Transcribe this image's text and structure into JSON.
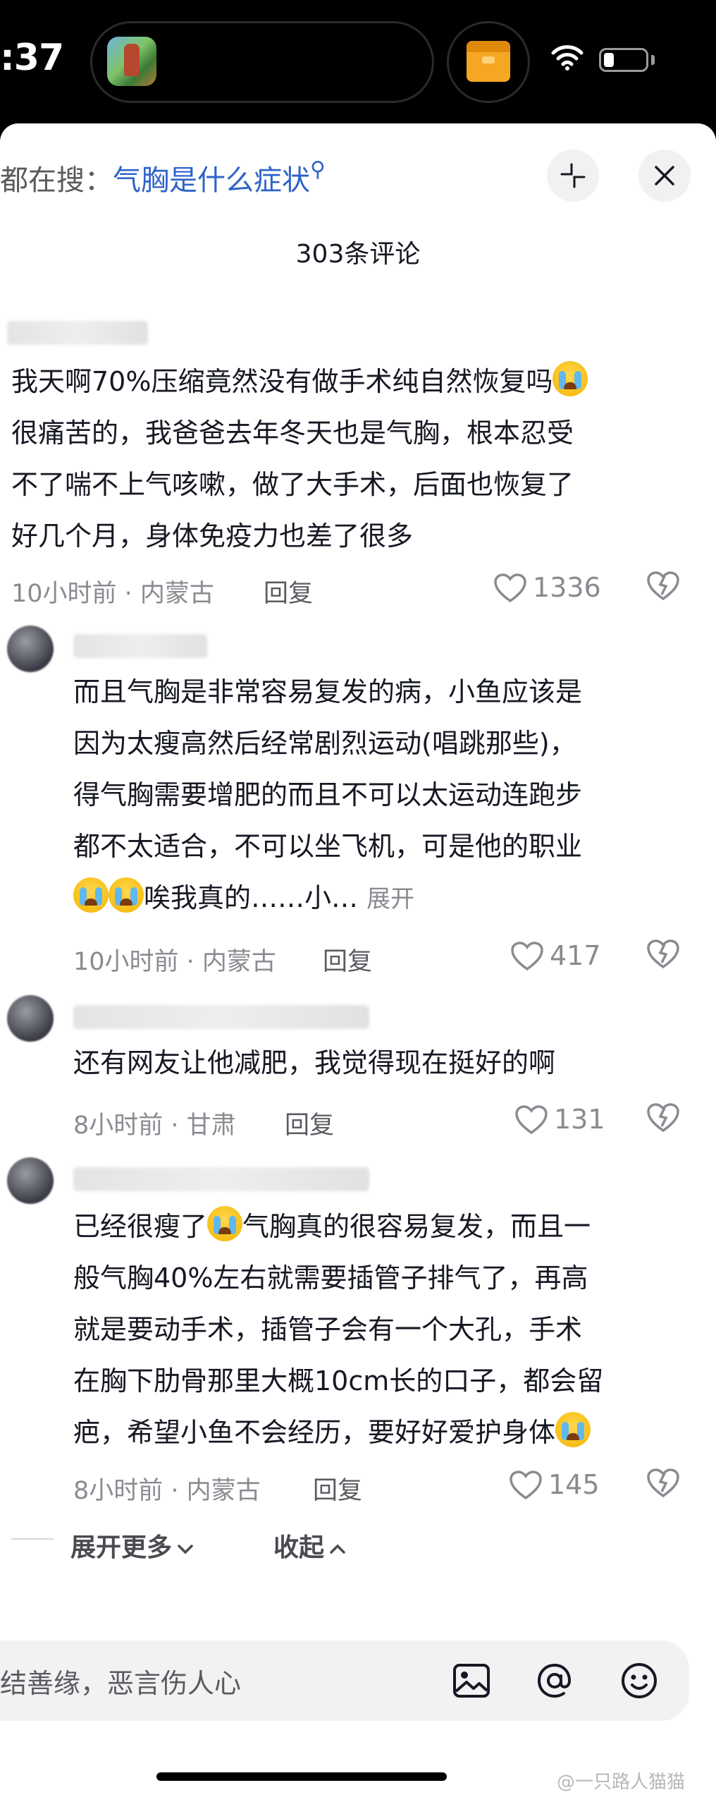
{
  "status_bar": {
    "time": ":37"
  },
  "header": {
    "search_prefix": "都在搜：",
    "search_query": "气胸是什么症状",
    "comment_count": "303条评论"
  },
  "comments": [
    {
      "lines": [
        "我天啊70%压缩竟然没有做手术纯自然恢复吗",
        "很痛苦的，我爸爸去年冬天也是气胸，根本忍受",
        "不了喘不上气咳嗽，做了大手术，后面也恢复了",
        "好几个月，身体免疫力也差了很多"
      ],
      "meta": "10小时前 · 内蒙古",
      "reply": "回复",
      "likes": "1336"
    },
    {
      "lines": [
        "而且气胸是非常容易复发的病，小鱼应该是",
        "因为太瘦高然后经常剧烈运动(唱跳那些)，",
        "得气胸需要增肥的而且不可以太运动连跑步",
        "都不太适合，不可以坐飞机，可是他的职业",
        "唉我真的……小…"
      ],
      "expand": "展开",
      "meta": "10小时前 · 内蒙古",
      "reply": "回复",
      "likes": "417"
    },
    {
      "lines": [
        "还有网友让他减肥，我觉得现在挺好的啊"
      ],
      "meta": "8小时前 · 甘肃",
      "reply": "回复",
      "likes": "131"
    },
    {
      "lines": [
        "已经很瘦了",
        "气胸真的很容易复发，而且一",
        "般气胸40%左右就需要插管子排气了，再高",
        "就是要动手术，插管子会有一个大孔，手术",
        "在胸下肋骨那里大概10cm长的口子，都会留",
        "疤，希望小鱼不会经历，要好好爱护身体"
      ],
      "meta": "8小时前 · 内蒙古",
      "reply": "回复",
      "likes": "145"
    }
  ],
  "expand_more": "展开更多",
  "collapse": "收起",
  "input": {
    "placeholder": "结善缘，恶言伤人心"
  },
  "watermark": "@一只路人猫猫",
  "icons": [
    "app-thumbnail-icon",
    "box-icon",
    "wifi-icon",
    "battery-icon",
    "collapse-icon",
    "close-icon",
    "heart-icon",
    "dislike-icon",
    "chevron-down-icon",
    "chevron-up-icon",
    "image-icon",
    "at-icon",
    "emoji-icon",
    "crying-emoji-icon"
  ],
  "colors": {
    "accent_link": "#2e63c9",
    "meta": "#8a8b91",
    "text": "#161823"
  }
}
